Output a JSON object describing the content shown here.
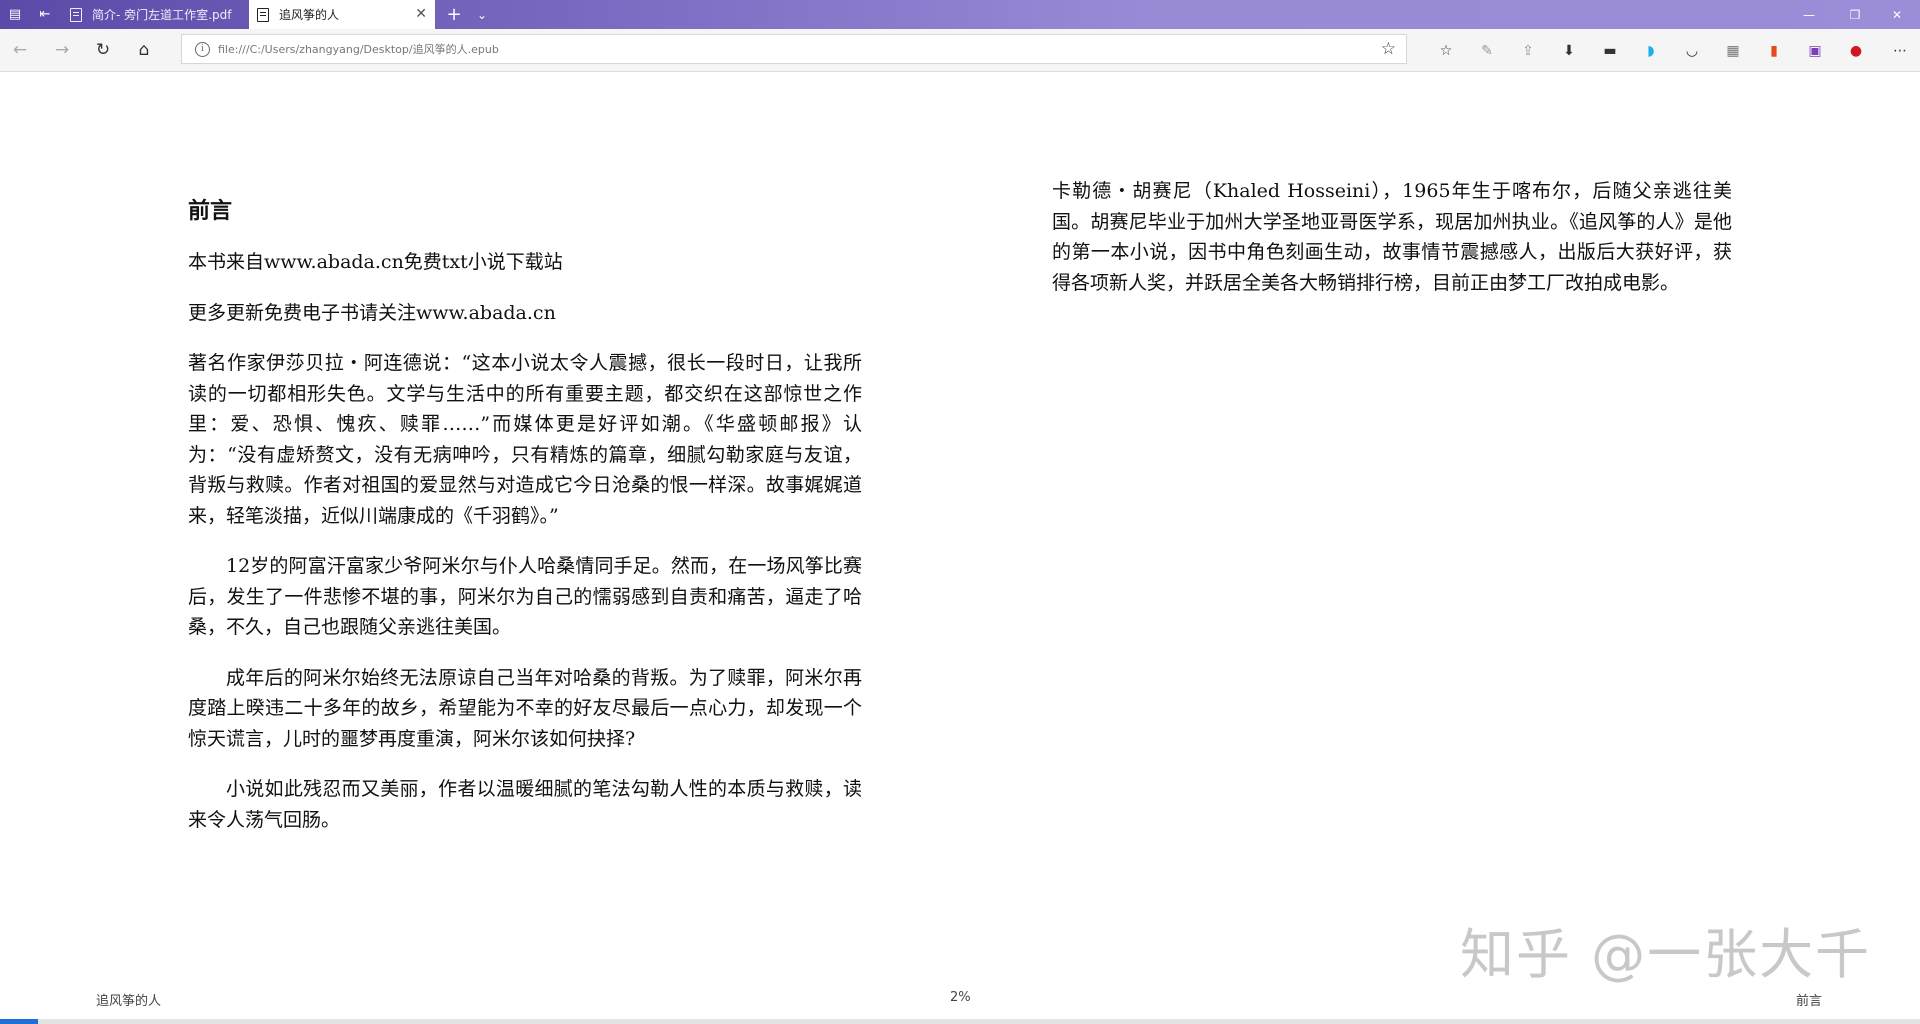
{
  "tabs": [
    {
      "label": "简介- 旁门左道工作室.pdf",
      "active": false
    },
    {
      "label": "追风筝的人",
      "active": true
    }
  ],
  "address": {
    "url": "file:///C:/Users/zhangyang/Desktop/追风筝的人.epub"
  },
  "book": {
    "heading": "前言",
    "left_paragraphs": [
      "本书来自www.abada.cn免费txt小说下载站",
      "更多更新免费电子书请关注www.abada.cn",
      "著名作家伊莎贝拉・阿连德说：“这本小说太令人震撼，很长一段时日，让我所读的一切都相形失色。文学与生活中的所有重要主题，都交织在这部惊世之作里：爱、恐惧、愧疚、赎罪……”而媒体更是好评如潮。《华盛顿邮报》认为：“没有虚矫赘文，没有无病呻吟，只有精炼的篇章，细腻勾勒家庭与友谊，背叛与救赎。作者对祖国的爱显然与对造成它今日沧桑的恨一样深。故事娓娓道来，轻笔淡描，近似川端康成的《千羽鹤》。”",
      "12岁的阿富汗富家少爷阿米尔与仆人哈桑情同手足。然而，在一场风筝比赛后，发生了一件悲惨不堪的事，阿米尔为自己的懦弱感到自责和痛苦，逼走了哈桑，不久，自己也跟随父亲逃往美国。",
      "成年后的阿米尔始终无法原谅自己当年对哈桑的背叛。为了赎罪，阿米尔再度踏上暌违二十多年的故乡，希望能为不幸的好友尽最后一点心力，却发现一个惊天谎言，儿时的噩梦再度重演，阿米尔该如何抉择?",
      "小说如此残忍而又美丽，作者以温暖细腻的笔法勾勒人性的本质与救赎，读来令人荡气回肠。"
    ],
    "right_paragraph": "卡勒德・胡赛尼（Khaled Hosseini），1965年生于喀布尔，后随父亲逃往美国。胡赛尼毕业于加州大学圣地亚哥医学系，现居加州执业。《追风筝的人》是他的第一本小说，因书中角色刻画生动，故事情节震撼感人，出版后大获好评，获得各项新人奖，并跃居全美各大畅销排行榜，目前正由梦工厂改拍成电影。"
  },
  "footer": {
    "book_title": "追风筝的人",
    "progress_label": "2%",
    "progress_value": 0.02,
    "chapter": "前言"
  },
  "watermark": "知乎 @一张大千",
  "colors": {
    "titlebar": "#7f6ec4",
    "progress": "#1f6fd8"
  }
}
